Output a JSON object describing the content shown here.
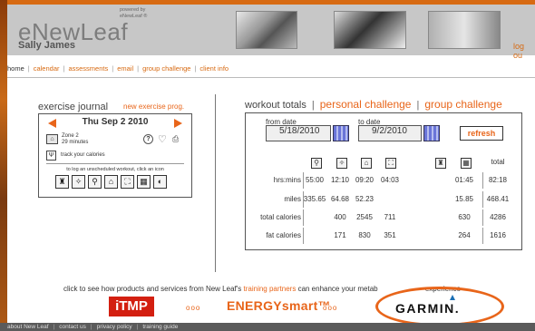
{
  "header": {
    "logo": "eNewLeaf",
    "powered_line1": "powered by",
    "powered_line2": "eNewLeaf ®",
    "user_name": "Sally James",
    "logout": "log ou"
  },
  "nav": {
    "items": [
      "home",
      "calendar",
      "assessments",
      "email",
      "group challenge",
      "client info"
    ]
  },
  "journal": {
    "title": "exercise journal",
    "new_link": "new exercise prog.",
    "date": "Thu Sep 2 2010",
    "zone_line1": "Zone 2",
    "zone_line2": "29 minutes",
    "calories_link": "track your calories",
    "log_hint": "to log an unscheduled workout, click an icon",
    "help": "?",
    "activity_icons": [
      "weights-icon",
      "stretch-icon",
      "walk-icon",
      "bike-icon",
      "rower-icon",
      "sport-icon",
      "tennis-icon"
    ]
  },
  "totals": {
    "title": "workout totals",
    "personal_challenge": "personal challenge",
    "group_challenge": "group challenge",
    "from_label": "from date",
    "to_label": "to date",
    "from_value": "5/18/2010",
    "to_value": "9/2/2010",
    "refresh": "refresh",
    "total_header": "total",
    "rows": [
      {
        "label": "hrs:mins",
        "cells": [
          "55:00",
          "12:10",
          "09:20",
          "04:03",
          "",
          "01:45",
          "82:18"
        ]
      },
      {
        "label": "miles",
        "cells": [
          "335.65",
          "64.68",
          "52.23",
          "",
          "",
          "15.85",
          "468.41"
        ]
      },
      {
        "label": "total calories",
        "cells": [
          "",
          "400",
          "2545",
          "711",
          "",
          "630",
          "4286"
        ]
      },
      {
        "label": "fat calories",
        "cells": [
          "",
          "171",
          "830",
          "351",
          "",
          "264",
          "1616"
        ]
      }
    ]
  },
  "partners": {
    "text_before": "click to see how products and services from New Leaf's",
    "link": "training partners",
    "text_after": "can enhance your metab",
    "text_tail": "experience",
    "itmp": "iTMP",
    "energy": "ENERGYsmart™",
    "garmin": "GARMIN."
  },
  "footer": {
    "items": [
      "about New Leaf",
      "contact us",
      "privacy policy",
      "training guide"
    ]
  },
  "colors": {
    "accent": "#e8651a",
    "header_bg": "#c7c7c7",
    "footer_bg": "#5b5b5b"
  }
}
